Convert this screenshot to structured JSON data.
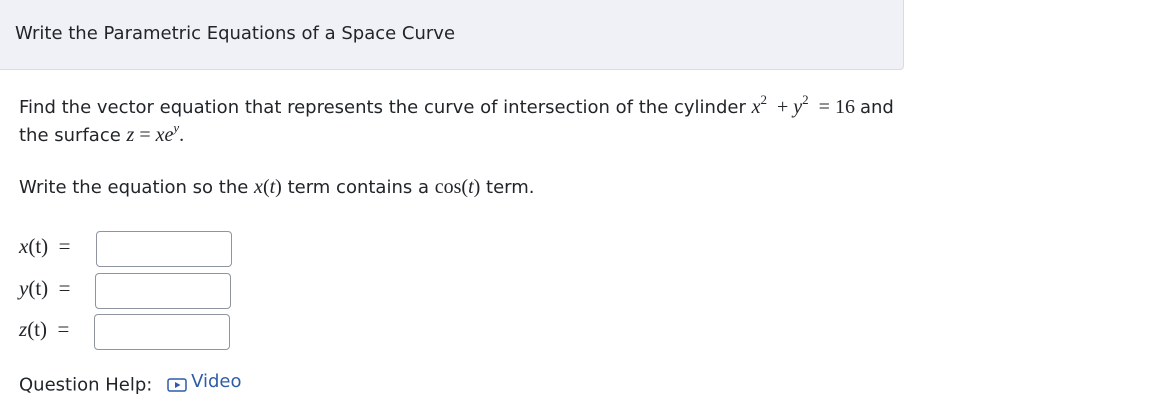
{
  "question": {
    "title": "Write the Parametric Equations of a Space Curve",
    "prompt_prefix": "Find the vector equation that represents the curve of intersection of the cylinder",
    "cylinder_equation": {
      "x": "x",
      "y": "y",
      "exp": "2",
      "rhs": "16"
    },
    "prompt_and": "and",
    "prompt_line2_prefix": "the surface",
    "surface_equation": {
      "z": "z",
      "x": "x",
      "e": "e",
      "exp": "y"
    },
    "instruction_prefix": "Write the equation so the",
    "instruction_xt": "x(t)",
    "instruction_middle": "term contains a",
    "instruction_cos": "cos(t)",
    "instruction_suffix": "term."
  },
  "answers": [
    {
      "label_var": "x",
      "label_arg": "(t)",
      "value": "",
      "placeholder": ""
    },
    {
      "label_var": "y",
      "label_arg": "(t)",
      "value": "",
      "placeholder": ""
    },
    {
      "label_var": "z",
      "label_arg": "(t)",
      "value": "",
      "placeholder": ""
    }
  ],
  "help": {
    "label": "Question Help:",
    "video_label": "Video",
    "icon": "play-video-icon",
    "link_color": "#2e5ca8"
  }
}
